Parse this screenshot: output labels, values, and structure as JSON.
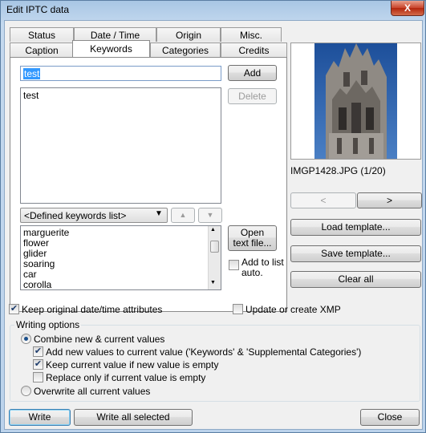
{
  "window": {
    "title": "Edit IPTC data",
    "close_glyph": "X"
  },
  "tabs": {
    "row1": [
      "Status",
      "Date / Time",
      "Origin",
      "Misc."
    ],
    "row2": [
      "Caption",
      "Keywords",
      "Categories",
      "Credits"
    ],
    "active": "Keywords"
  },
  "keywords": {
    "input_value": "test",
    "add_label": "Add",
    "delete_label": "Delete",
    "list_items": [
      "test"
    ],
    "defined_list_selected": "<Defined keywords list>",
    "up_glyph": "▲",
    "down_glyph": "▼",
    "defined_items": [
      "marguerite",
      "flower",
      "glider",
      "soaring",
      "car",
      "corolla"
    ],
    "open_text_file_label": "Open text file...",
    "add_to_list_label": "Add to list auto."
  },
  "preview": {
    "caption": "IMGP1428.JPG (1/20)",
    "prev_glyph": "<",
    "next_glyph": ">",
    "load_template_label": "Load template...",
    "save_template_label": "Save template...",
    "clear_all_label": "Clear all"
  },
  "options": {
    "keep_date_label": "Keep original date/time attributes",
    "keep_date_checked": true,
    "update_xmp_label": "Update or create XMP",
    "update_xmp_checked": false,
    "writing_options_title": "Writing options",
    "combine_label": "Combine new & current values",
    "add_new_label": "Add new values to current value ('Keywords' & 'Supplemental Categories')",
    "keep_current_label": "Keep current value if new value is empty",
    "replace_only_label": "Replace only if current value is empty",
    "overwrite_label": "Overwrite all current values",
    "check_glyph": "✔"
  },
  "footer": {
    "write_label": "Write",
    "write_all_label": "Write all selected",
    "close_label": "Close"
  }
}
